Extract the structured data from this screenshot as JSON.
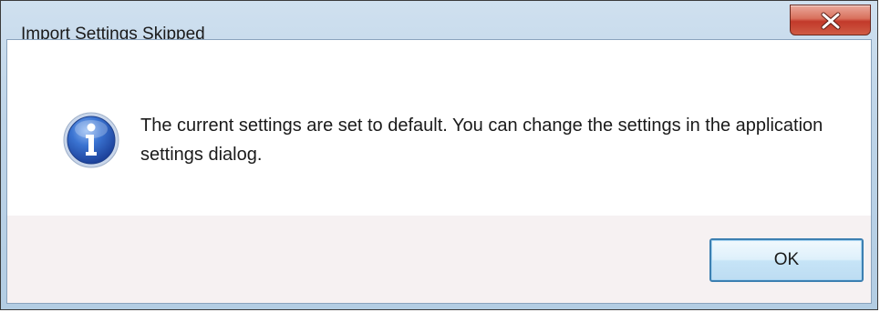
{
  "dialog": {
    "title": "Import Settings Skipped",
    "message": "The current settings are set to default. You can change the settings in the application settings dialog.",
    "icon": "information-icon",
    "close_icon": "close-icon"
  },
  "buttons": {
    "ok_label": "OK"
  },
  "colors": {
    "close_button": "#c2392a",
    "ok_button_border": "#3c7fb1",
    "footer_background": "#f6f1f2",
    "info_icon_blue": "#2f63c0"
  }
}
